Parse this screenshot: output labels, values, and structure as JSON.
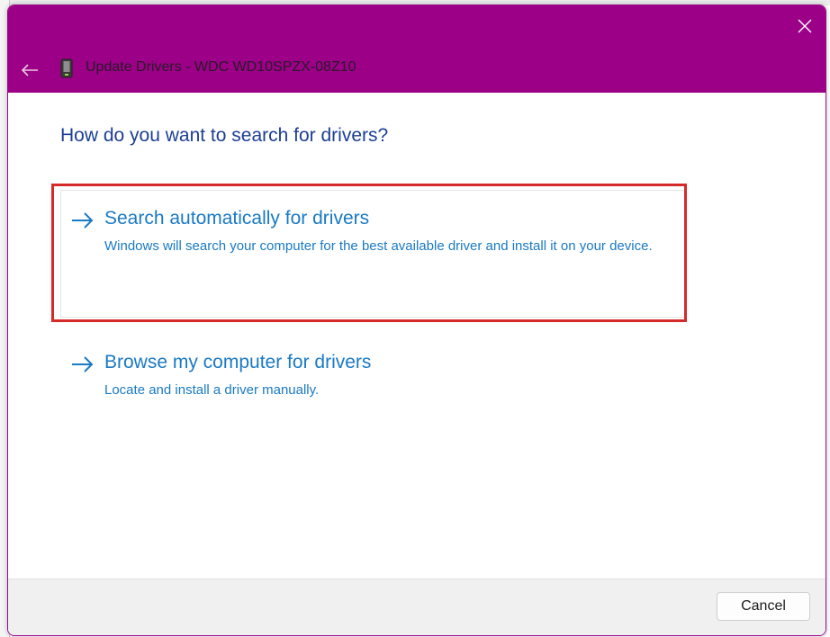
{
  "window": {
    "header_title": "Update Drivers - WDC WD10SPZX-08Z10",
    "accent_color": "#9b0087"
  },
  "content": {
    "question": "How do you want to search for drivers?",
    "options": [
      {
        "title": "Search automatically for drivers",
        "description": "Windows will search your computer for the best available driver and install it on your device.",
        "highlighted": true
      },
      {
        "title": "Browse my computer for drivers",
        "description": "Locate and install a driver manually.",
        "highlighted": false
      }
    ]
  },
  "footer": {
    "cancel_label": "Cancel"
  },
  "icons": {
    "close": "close-icon",
    "back": "back-arrow-icon",
    "device": "hard-drive-icon",
    "option_arrow": "arrow-right-icon"
  }
}
